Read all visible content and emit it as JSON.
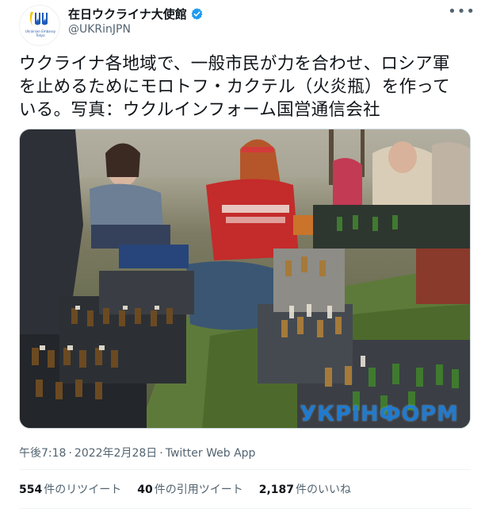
{
  "account": {
    "display_name": "在日ウクライナ大使館",
    "handle": "@UKRinJPN",
    "avatar_caption": "Ukrainian Embassy Tokyo",
    "verified_icon": "verified-badge-icon",
    "colors": {
      "verified": "#1d9bf0",
      "flag_blue": "#1e5bb8",
      "flag_yellow": "#f5c400"
    }
  },
  "tweet": {
    "text": "ウクライナ各地域で、一般市民が力を合わせ、ロシア軍を止めるためにモロトフ・カクテル（火炎瓶）を作っている。写真：ウクルインフォーム国営通信会社",
    "photo_watermark": "УКРІНФОРМ"
  },
  "meta": {
    "time": "午後7:18",
    "date": "2022年2月28日",
    "separator": "·",
    "source": "Twitter Web App"
  },
  "stats": {
    "retweets_count": "554",
    "retweets_label": "件のリツイート",
    "quotes_count": "40",
    "quotes_label": "件の引用ツイート",
    "likes_count": "2,187",
    "likes_label": "件のいいね"
  },
  "more_icon": "more-options-icon"
}
